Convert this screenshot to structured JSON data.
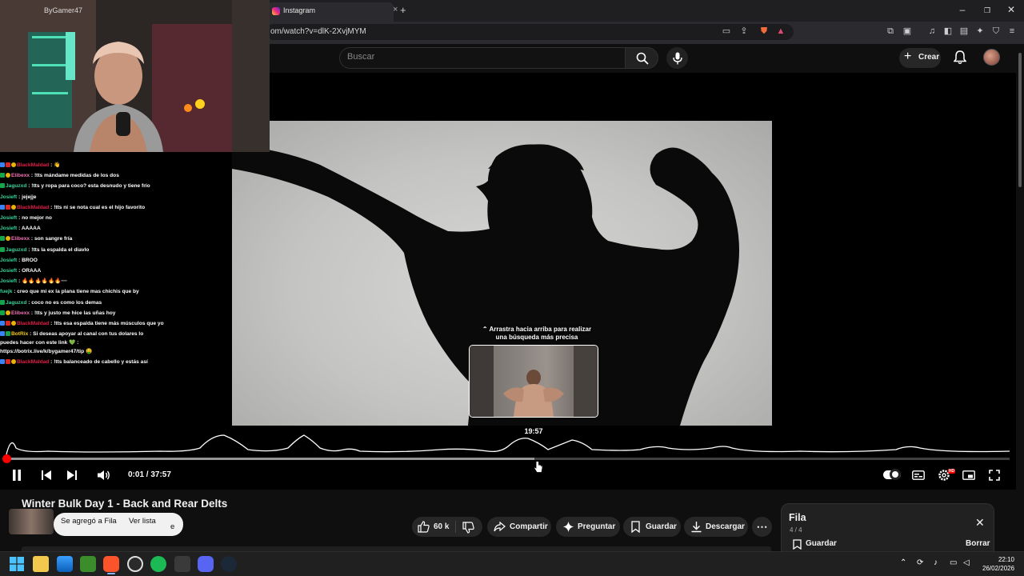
{
  "browser": {
    "tab_title": "Instagram",
    "url": "om/watch?v=dlK-2XvjMYM",
    "accent": "#ff0000"
  },
  "header": {
    "search_placeholder": "Buscar",
    "create_label": "Crear"
  },
  "webcam": {
    "overlay_text": "ByGamer47"
  },
  "player": {
    "seek_hint": "Arrastra hacia arriba para realizar una búsqueda más precisa",
    "preview_time": "19:57",
    "time_display": "0:01 / 37:57",
    "played_fraction": 0.0004,
    "hover_fraction": 0.526
  },
  "chat": [
    {
      "user": "BlackMaldad",
      "color": "red",
      "badges": [
        "blue",
        "red",
        "gold"
      ],
      "msg": "👋"
    },
    {
      "user": "Elibexx",
      "color": "pink",
      "badges": [
        "lime",
        "gold"
      ],
      "msg": "!tts mándame medidas de los dos"
    },
    {
      "user": "Jaguzxd",
      "color": "green",
      "badges": [
        "lime"
      ],
      "msg": "!tts y ropa para coco? esta desnudo y tiene frío"
    },
    {
      "user": "Josieft",
      "color": "green",
      "badges": [],
      "msg": "jejejje"
    },
    {
      "user": "BlackMaldad",
      "color": "red",
      "badges": [
        "blue",
        "red",
        "gold"
      ],
      "msg": "!tts ni se nota cual es el hijo favorito"
    },
    {
      "user": "Josieft",
      "color": "green",
      "badges": [],
      "msg": "no mejor no"
    },
    {
      "user": "Josieft",
      "color": "green",
      "badges": [],
      "msg": "AAAAA"
    },
    {
      "user": "Elibexx",
      "color": "pink",
      "badges": [
        "lime",
        "gold"
      ],
      "msg": "son sangre fría"
    },
    {
      "user": "Jaguzxd",
      "color": "green",
      "badges": [
        "lime"
      ],
      "msg": "!tts la espalda el diavlo"
    },
    {
      "user": "Josieft",
      "color": "green",
      "badges": [],
      "msg": "BROO"
    },
    {
      "user": "Josieft",
      "color": "green",
      "badges": [],
      "msg": "ORAAA"
    },
    {
      "user": "Josieft",
      "color": "green",
      "badges": [],
      "msg": "🔥🔥🔥🔥🔥🔥➖"
    },
    {
      "user": "fuejk",
      "color": "green",
      "badges": [],
      "msg": "creo que mi ex la plana tiene mas chichis que by"
    },
    {
      "user": "Jaguzxd",
      "color": "green",
      "badges": [
        "lime"
      ],
      "msg": "coco no es como los demas"
    },
    {
      "user": "Elibexx",
      "color": "pink",
      "badges": [
        "lime",
        "gold"
      ],
      "msg": "!tts y justo me hice las uñas hoy"
    },
    {
      "user": "BlackMaldad",
      "color": "red",
      "badges": [
        "blue",
        "red",
        "gold"
      ],
      "msg": "!tts esa espalda tiene más músculos que yo"
    },
    {
      "user": "BotRix",
      "color": "yellow",
      "badges": [
        "blue",
        "green"
      ],
      "msg": "Si deseas apoyar al canal con tus dolares lo puedes hacer con este link 💚 : https://botrix.live/k/bygamer47/tip 🤑"
    },
    {
      "user": "BlackMaldad",
      "color": "red",
      "badges": [
        "blue",
        "red",
        "gold"
      ],
      "msg": "!tts balanceado de cabello y estás así"
    }
  ],
  "video": {
    "title": "Winter Bulk Day 1 - Back and Rear Delts"
  },
  "toast": {
    "text": "Se agregó a Fila",
    "link": "Ver lista",
    "trailing": "e"
  },
  "actions": {
    "likes": "60 k",
    "share": "Compartir",
    "ask": "Preguntar",
    "save": "Guardar",
    "download": "Descargar"
  },
  "queue": {
    "title": "Fila",
    "count": "4 / 4",
    "save": "Guardar",
    "clear": "Borrar"
  },
  "taskbar": {
    "time": "22:10",
    "date": "26/02/2026"
  }
}
